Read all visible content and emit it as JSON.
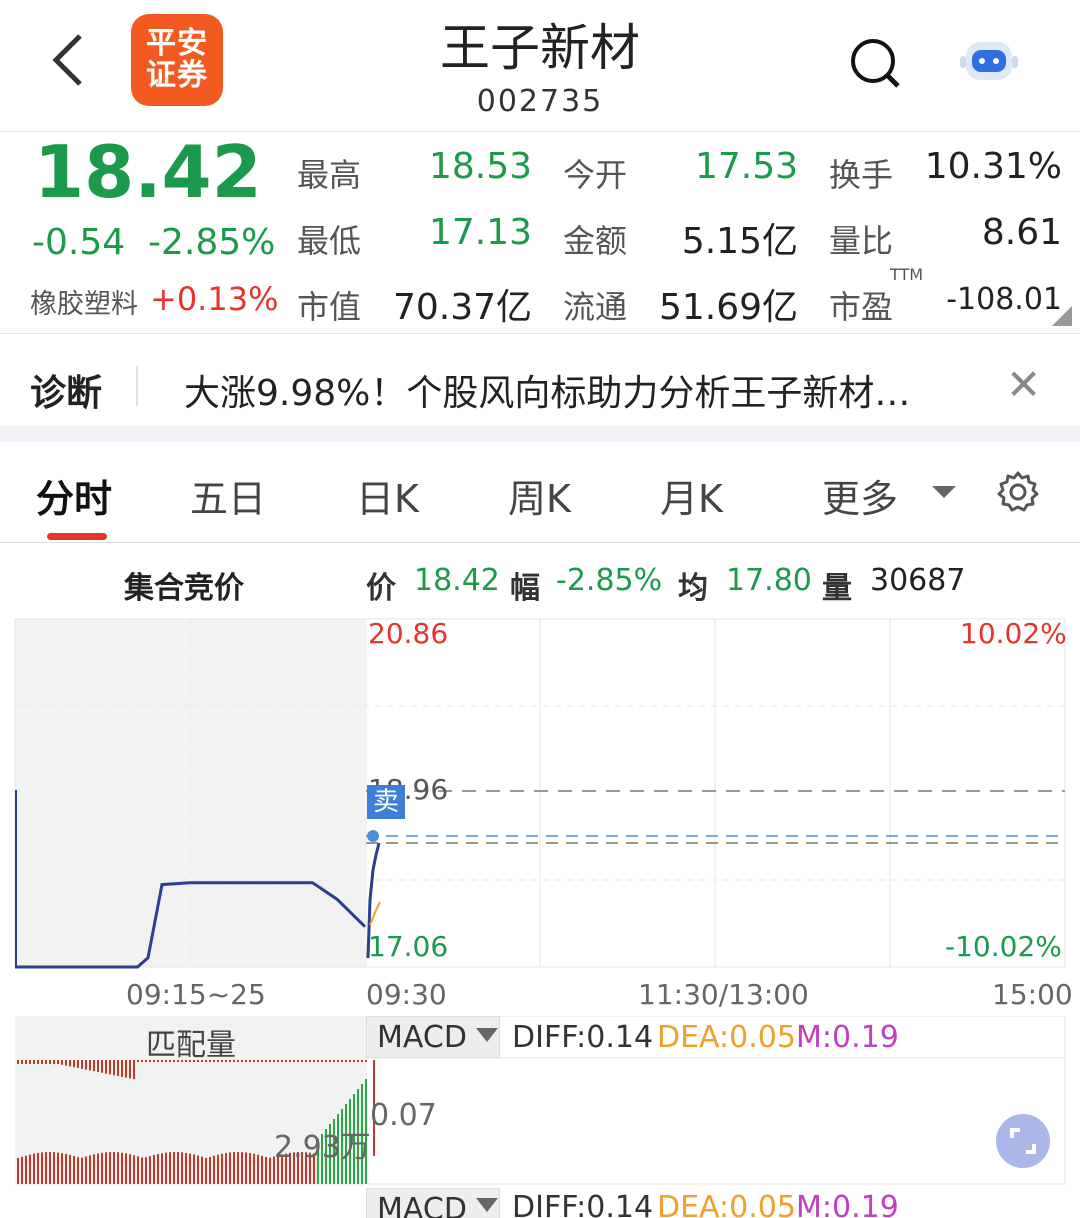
{
  "header": {
    "back_icon": "chevron-left-icon",
    "broker_logo_line1": "平安",
    "broker_logo_line2": "证券",
    "stock_name": "王子新材",
    "stock_code": "002735",
    "search_icon": "search-icon",
    "assistant_icon": "robot-icon"
  },
  "quote": {
    "price": "18.42",
    "change": "-0.54",
    "change_pct": "-2.85%",
    "sector_name": "橡胶塑料",
    "sector_change": "+0.13%",
    "fields": {
      "high_label": "最高",
      "high": "18.53",
      "open_label": "今开",
      "open": "17.53",
      "turnover_label": "换手",
      "turnover": "10.31%",
      "low_label": "最低",
      "low": "17.13",
      "amount_label": "金额",
      "amount": "5.15亿",
      "vol_ratio_label": "量比",
      "vol_ratio": "8.61",
      "mktcap_label": "市值",
      "mktcap": "70.37亿",
      "float_label": "流通",
      "float_cap": "51.69亿",
      "pe_label": "市盈",
      "pe_sup": "TTM",
      "pe": "-108.01"
    }
  },
  "diagnosis": {
    "label": "诊断",
    "text": "大涨9.98%！个股风向标助力分析王子新材…",
    "close_icon": "close-icon"
  },
  "tabs": [
    {
      "label": "分时",
      "active": true
    },
    {
      "label": "五日"
    },
    {
      "label": "日K"
    },
    {
      "label": "周K"
    },
    {
      "label": "月K"
    },
    {
      "label": "更多"
    }
  ],
  "settings_icon": "gear-icon",
  "infobar": {
    "auction_label": "集合竞价",
    "price_k": "价",
    "price_v": "18.42",
    "pct_k": "幅",
    "pct_v": "-2.85%",
    "avg_k": "均",
    "avg_v": "17.80",
    "vol_k": "量",
    "vol_v": "30687"
  },
  "chart_data": {
    "type": "line",
    "y_labels": {
      "top_price": "20.86",
      "mid_price": "18.96",
      "bottom_price": "17.06",
      "top_pct": "10.02%",
      "bottom_pct": "-10.02%"
    },
    "x_labels": [
      "09:15~25",
      "09:30",
      "11:30/13:00",
      "15:00"
    ],
    "ylim": [
      17.06,
      20.86
    ],
    "auction_series": [
      {
        "t": 0,
        "v": 17.06
      },
      {
        "t": 0.35,
        "v": 17.06
      },
      {
        "t": 0.38,
        "v": 17.16
      },
      {
        "t": 0.42,
        "v": 17.96
      },
      {
        "t": 0.5,
        "v": 17.98
      },
      {
        "t": 0.85,
        "v": 17.98
      },
      {
        "t": 0.92,
        "v": 17.8
      },
      {
        "t": 1.0,
        "v": 17.5
      }
    ],
    "session_last_price": 18.42,
    "avg_price": 17.8,
    "sell_marker": "卖",
    "volume_label": "2.93万",
    "volume_label_title": "匹配量"
  },
  "macd": {
    "selector": "MACD",
    "diff": "DIFF:0.14",
    "dea": "DEA:0.05",
    "m": "M:0.19",
    "axis_value": "0.07",
    "colors": {
      "dea": "#f0a030",
      "m": "#c040c0"
    }
  },
  "expand_icon": "expand-icon"
}
